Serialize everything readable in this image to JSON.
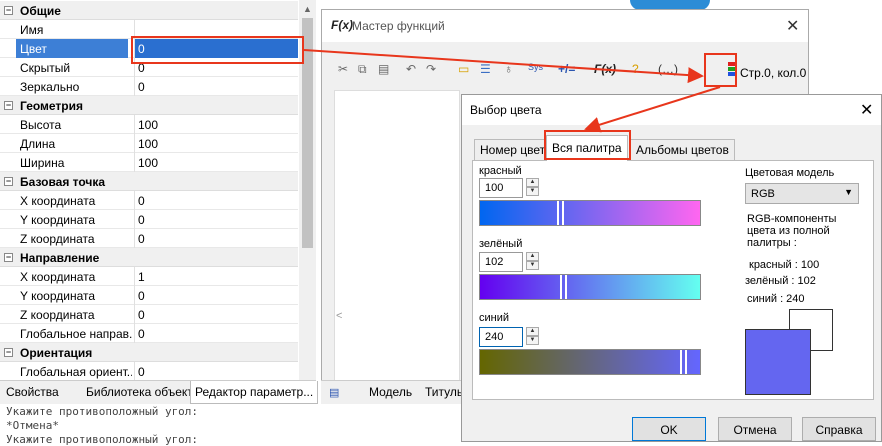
{
  "properties": {
    "groups": [
      {
        "label": "Общие",
        "rows": [
          {
            "key": "Имя",
            "value": ""
          },
          {
            "key": "Цвет",
            "value": "0"
          },
          {
            "key": "Скрытый",
            "value": "0"
          },
          {
            "key": "Зеркально",
            "value": "0"
          }
        ]
      },
      {
        "label": "Геометрия",
        "rows": [
          {
            "key": "Высота",
            "value": "100"
          },
          {
            "key": "Длина",
            "value": "100"
          },
          {
            "key": "Ширина",
            "value": "100"
          }
        ]
      },
      {
        "label": "Базовая точка",
        "rows": [
          {
            "key": "X координата",
            "value": "0"
          },
          {
            "key": "Y координата",
            "value": "0"
          },
          {
            "key": "Z координата",
            "value": "0"
          }
        ]
      },
      {
        "label": "Направление",
        "rows": [
          {
            "key": "X координата",
            "value": "1"
          },
          {
            "key": "Y координата",
            "value": "0"
          },
          {
            "key": "Z координата",
            "value": "0"
          },
          {
            "key": "Глобальное направ...",
            "value": "0"
          }
        ]
      },
      {
        "label": "Ориентация",
        "rows": [
          {
            "key": "Глобальная ориент...",
            "value": "0"
          }
        ]
      }
    ],
    "group_toggle": "−"
  },
  "bottom_tabs": [
    "Свойства",
    "Библиотека объектов",
    "Редактор параметр..."
  ],
  "console": [
    "Укажите противоположный угол:",
    "*Отмена*",
    "Укажите противоположный угол:"
  ],
  "function_wizard": {
    "title": "Мастер функций",
    "icon_text": "F(x)",
    "close": "✕",
    "status": "Стр.0, кол.0",
    "tools": {
      "sys": "Sys",
      "ops": "+/=",
      "fx": "F(x)",
      "dots": "(…)",
      "hleft": "<"
    }
  },
  "model_tabs": [
    "Модель",
    "Титуль"
  ],
  "color_dialog": {
    "title": "Выбор цвета",
    "close": "✕",
    "tabs": [
      "Номер цвета",
      "Вся палитра",
      "Альбомы цветов"
    ],
    "red_label": "красный",
    "red_value": "100",
    "green_label": "зелёный",
    "green_value": "102",
    "blue_label": "синий",
    "blue_value": "240",
    "model_label": "Цветовая модель",
    "model_value": "RGB",
    "info_lines": [
      "RGB-компоненты",
      "цвета из полной",
      "палитры :"
    ],
    "info_red": "красный   : 100",
    "info_green": "зелёный : 102",
    "info_blue": "синий    : 240",
    "ok": "OK",
    "cancel": "Отмена",
    "help": "Справка",
    "selected_color": "#6466f0"
  }
}
